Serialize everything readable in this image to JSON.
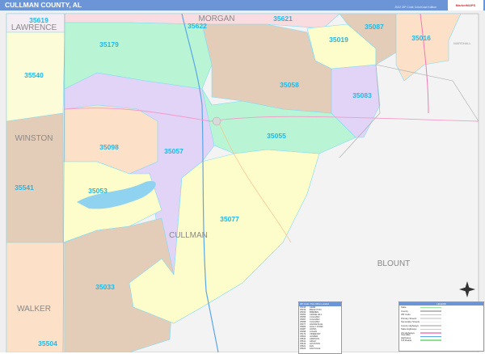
{
  "header": {
    "title": "CULLMAN COUNTY, AL",
    "edition": "2022 ZIP Code ColorCast Edition",
    "logo": "MarketMAPS"
  },
  "map": {
    "zip_labels": [
      "35619",
      "35622",
      "35621",
      "35087",
      "35016",
      "35179",
      "35019",
      "35540",
      "35058",
      "35083",
      "35055",
      "35098",
      "35057",
      "WINSTON",
      "35053",
      "35541",
      "35077",
      "35033",
      "35504"
    ],
    "counties": {
      "lawrence": "LAWRENCE",
      "morgan": "MORGAN",
      "winston": "WINSTON",
      "cullman": "CULLMAN",
      "blount": "BLOUNT",
      "walker": "WALKER",
      "marshall": "MARSHALL"
    },
    "colors": {
      "green": "#b9f5d4",
      "purple": "#e1d4f7",
      "yellow": "#fdfccb",
      "tan": "#e3cdb8",
      "peach": "#fde0c8",
      "pink": "#f9dce0",
      "gray": "#efefef",
      "label": "#1fb8e8"
    }
  },
  "zip_table": {
    "title": "ZIP Code / Post Office Location",
    "rows": [
      [
        "35016",
        "ARAB"
      ],
      [
        "35019",
        "BAILEYTON"
      ],
      [
        "35033",
        "BREMEN"
      ],
      [
        "35053",
        "CRANE HILL"
      ],
      [
        "35055",
        "CULLMAN"
      ],
      [
        "35057",
        "CULLMAN"
      ],
      [
        "35058",
        "CULLMAN"
      ],
      [
        "35077",
        "HANCEVILLE"
      ],
      [
        "35083",
        "HOLLY POND"
      ],
      [
        "35087",
        "JOPPA"
      ],
      [
        "35098",
        "LOGAN"
      ],
      [
        "35179",
        "VINEMONT"
      ],
      [
        "35504",
        "JASPER"
      ],
      [
        "35540",
        "ADDISON"
      ],
      [
        "35541",
        "ARLEY"
      ],
      [
        "35619",
        "HOUSTON"
      ],
      [
        "35621",
        "EVA"
      ],
      [
        "35622",
        "FALKVILLE"
      ]
    ]
  },
  "legend": {
    "title": "LEGEND",
    "items": [
      "State",
      "County",
      "ZIP Code",
      "Primary Streets",
      "Secondary Streets",
      "County Highways",
      "State Highways",
      "US Highways",
      "Interstate Highways",
      "Toll Roads"
    ],
    "item_colors": [
      "#9be89b",
      "#bbbbbb",
      "#7fdcf5",
      "#dddddd",
      "#eeeeee",
      "#cccccc",
      "#f7c48a",
      "#f49ac8",
      "#5aa7e8",
      "#8fe08f"
    ]
  }
}
